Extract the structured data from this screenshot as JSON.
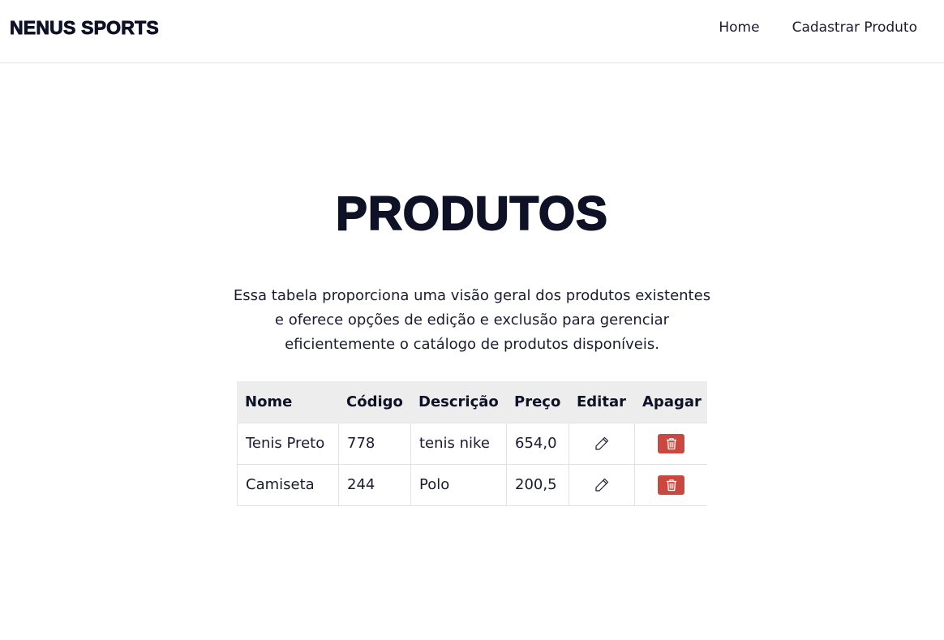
{
  "navbar": {
    "brand": "NENUS SPORTS",
    "links": [
      {
        "label": "Home"
      },
      {
        "label": "Cadastrar Produto"
      }
    ]
  },
  "main": {
    "title": "PRODUTOS",
    "description": "Essa tabela proporciona uma visão geral dos produtos existentes e oferece opções de edição e exclusão para gerenciar eficientemente o catálogo de produtos disponíveis."
  },
  "table": {
    "headers": {
      "nome": "Nome",
      "codigo": "Código",
      "descricao": "Descrição",
      "preco": "Preço",
      "editar": "Editar",
      "apagar": "Apagar"
    },
    "rows": [
      {
        "nome": "Tenis Preto",
        "codigo": "778",
        "descricao": "tenis nike",
        "preco": "654,0"
      },
      {
        "nome": "Camiseta",
        "codigo": "244",
        "descricao": "Polo",
        "preco": "200,5"
      }
    ],
    "icons": {
      "edit": "pencil-icon",
      "delete": "trash-icon"
    }
  },
  "colors": {
    "text_dark": "#0f1126",
    "header_bg": "#ededed",
    "delete_button": "#c9483f"
  }
}
